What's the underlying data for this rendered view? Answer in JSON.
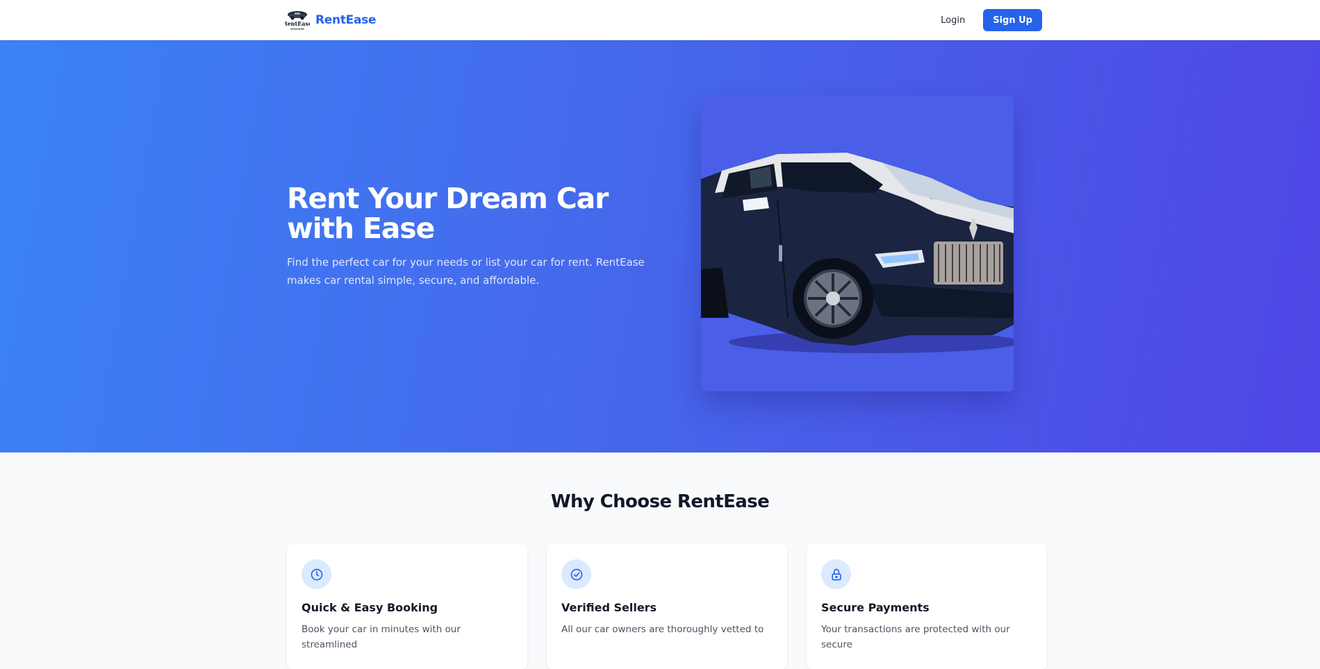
{
  "nav": {
    "logo_text": "RentEase",
    "brand": "RentEase",
    "login": "Login",
    "signup": "Sign Up"
  },
  "hero": {
    "title": "Rent Your Dream Car with Ease",
    "subtitle": "Find the perfect car for your needs or list your car for rent. RentEase makes car rental simple, secure, and affordable.",
    "image": "luxury-car-photo"
  },
  "features": {
    "title": "Why Choose RentEase",
    "cards": [
      {
        "icon": "clock-icon",
        "title": "Quick & Easy Booking",
        "desc": "Book your car in minutes with our streamlined"
      },
      {
        "icon": "check-circle-icon",
        "title": "Verified Sellers",
        "desc": "All our car owners are thoroughly vetted to"
      },
      {
        "icon": "lock-icon",
        "title": "Secure Payments",
        "desc": "Your transactions are protected with our secure"
      }
    ]
  },
  "colors": {
    "brand": "#2563eb",
    "hero_start": "#3b82f6",
    "hero_end": "#4f46e5",
    "icon_bg": "#dbeafe"
  }
}
